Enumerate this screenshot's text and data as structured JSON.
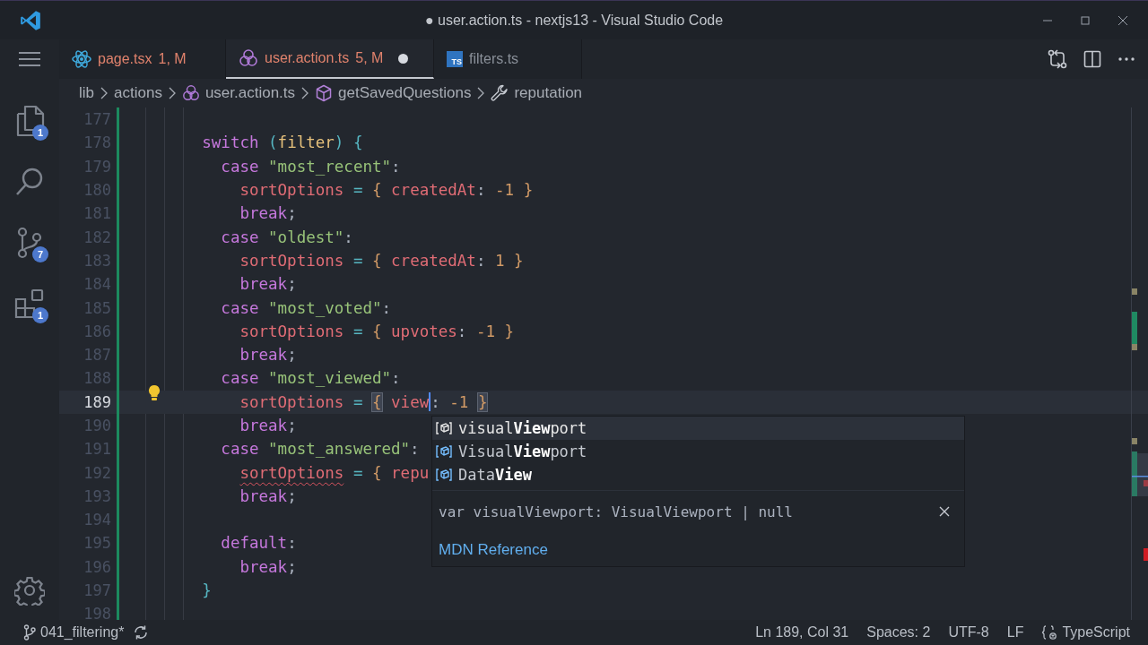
{
  "window": {
    "title": "● user.action.ts - nextjs13 - Visual Studio Code"
  },
  "activity_bar": {
    "items": [
      {
        "kind": "explorer",
        "badge": "1"
      },
      {
        "kind": "search"
      },
      {
        "kind": "source-control",
        "badge": "7"
      },
      {
        "kind": "extensions",
        "badge": "1"
      }
    ]
  },
  "tabs": [
    {
      "label": "page.tsx",
      "status": "1, M",
      "kind": "react",
      "has_errors": true,
      "dirty": false,
      "selected": false
    },
    {
      "label": "user.action.ts",
      "status": "5, M",
      "kind": "module",
      "has_errors": true,
      "dirty": true,
      "selected": true
    },
    {
      "label": "filters.ts",
      "kind": "ts",
      "icon_text": "TS",
      "has_errors": false,
      "dirty": false,
      "selected": false
    }
  ],
  "breadcrumbs": [
    {
      "label": "lib",
      "kind": "folder"
    },
    {
      "label": "actions",
      "kind": "folder"
    },
    {
      "label": "user.action.ts",
      "kind": "module"
    },
    {
      "label": "getSavedQuestions",
      "kind": "method"
    },
    {
      "label": "reputation",
      "kind": "property"
    }
  ],
  "editor": {
    "lines": [
      {
        "number": "177",
        "current": false
      },
      {
        "number": "178",
        "current": false,
        "tokens": [
          {
            "text": "        switch",
            "kind": "kw"
          },
          {
            "text": " (",
            "kind": "op"
          },
          {
            "text": "filter",
            "kind": "param"
          },
          {
            "text": ")",
            "kind": "op"
          },
          {
            "text": " {",
            "kind": "op"
          }
        ]
      },
      {
        "number": "179",
        "current": false,
        "tokens": [
          {
            "text": "          case",
            "kind": "kw"
          },
          {
            "text": " \"most_recent\"",
            "kind": "str"
          },
          {
            "text": ":",
            "kind": "plain"
          }
        ]
      },
      {
        "number": "180",
        "current": false,
        "tokens": [
          {
            "text": "            sortOptions",
            "kind": "var"
          },
          {
            "text": " =",
            "kind": "op"
          },
          {
            "text": " {",
            "kind": "brace"
          },
          {
            "text": " createdAt",
            "kind": "var"
          },
          {
            "text": ":",
            "kind": "plain"
          },
          {
            "text": " -1",
            "kind": "num"
          },
          {
            "text": " }",
            "kind": "brace"
          }
        ]
      },
      {
        "number": "181",
        "current": false,
        "tokens": [
          {
            "text": "            break",
            "kind": "kw"
          },
          {
            "text": ";",
            "kind": "plain"
          }
        ]
      },
      {
        "number": "182",
        "current": false,
        "tokens": [
          {
            "text": "          case",
            "kind": "kw"
          },
          {
            "text": " \"oldest\"",
            "kind": "str"
          },
          {
            "text": ":",
            "kind": "plain"
          }
        ]
      },
      {
        "number": "183",
        "current": false,
        "tokens": [
          {
            "text": "            sortOptions",
            "kind": "var"
          },
          {
            "text": " =",
            "kind": "op"
          },
          {
            "text": " {",
            "kind": "brace"
          },
          {
            "text": " createdAt",
            "kind": "var"
          },
          {
            "text": ":",
            "kind": "plain"
          },
          {
            "text": " 1",
            "kind": "num"
          },
          {
            "text": " }",
            "kind": "brace"
          }
        ]
      },
      {
        "number": "184",
        "current": false,
        "tokens": [
          {
            "text": "            break",
            "kind": "kw"
          },
          {
            "text": ";",
            "kind": "plain"
          }
        ]
      },
      {
        "number": "185",
        "current": false,
        "tokens": [
          {
            "text": "          case",
            "kind": "kw"
          },
          {
            "text": " \"most_voted\"",
            "kind": "str"
          },
          {
            "text": ":",
            "kind": "plain"
          }
        ]
      },
      {
        "number": "186",
        "current": false,
        "tokens": [
          {
            "text": "            sortOptions",
            "kind": "var"
          },
          {
            "text": " =",
            "kind": "op"
          },
          {
            "text": " {",
            "kind": "brace"
          },
          {
            "text": " upvotes",
            "kind": "var"
          },
          {
            "text": ":",
            "kind": "plain"
          },
          {
            "text": " -1",
            "kind": "num"
          },
          {
            "text": " }",
            "kind": "brace"
          }
        ]
      },
      {
        "number": "187",
        "current": false,
        "tokens": [
          {
            "text": "            break",
            "kind": "kw"
          },
          {
            "text": ";",
            "kind": "plain"
          }
        ]
      },
      {
        "number": "188",
        "current": false,
        "tokens": [
          {
            "text": "          case",
            "kind": "kw"
          },
          {
            "text": " \"most_viewed\"",
            "kind": "str"
          },
          {
            "text": ":",
            "kind": "plain"
          }
        ]
      },
      {
        "number": "189",
        "current": true,
        "lightbulb": true,
        "tokens": [
          {
            "text": "            sortOptions",
            "kind": "var"
          },
          {
            "text": " = ",
            "kind": "op"
          },
          {
            "text": "{",
            "kind": "brace",
            "matched": true
          },
          {
            "text": " view",
            "kind": "var",
            "cursor": true
          },
          {
            "text": ":",
            "kind": "plain"
          },
          {
            "text": " -1 ",
            "kind": "num"
          },
          {
            "text": "}",
            "kind": "brace",
            "matched": true
          }
        ]
      },
      {
        "number": "190",
        "current": false,
        "tokens": [
          {
            "text": "            break",
            "kind": "kw"
          },
          {
            "text": ";",
            "kind": "plain"
          }
        ]
      },
      {
        "number": "191",
        "current": false,
        "tokens": [
          {
            "text": "          case",
            "kind": "kw"
          },
          {
            "text": " \"most_answered\"",
            "kind": "str"
          },
          {
            "text": ":",
            "kind": "plain"
          }
        ]
      },
      {
        "number": "192",
        "current": false,
        "tokens": [
          {
            "text": "            sortOptions",
            "kind": "var",
            "error": true
          },
          {
            "text": " =",
            "kind": "op"
          },
          {
            "text": " {",
            "kind": "brace"
          },
          {
            "text": " repu",
            "kind": "var"
          }
        ]
      },
      {
        "number": "193",
        "current": false,
        "tokens": [
          {
            "text": "            break",
            "kind": "kw"
          },
          {
            "text": ";",
            "kind": "plain"
          }
        ]
      },
      {
        "number": "194",
        "current": false
      },
      {
        "number": "195",
        "current": false,
        "tokens": [
          {
            "text": "          default",
            "kind": "kw"
          },
          {
            "text": ":",
            "kind": "plain"
          }
        ]
      },
      {
        "number": "196",
        "current": false,
        "tokens": [
          {
            "text": "            break",
            "kind": "kw"
          },
          {
            "text": ";",
            "kind": "plain"
          }
        ]
      },
      {
        "number": "197",
        "current": false,
        "tokens": [
          {
            "text": "        }",
            "kind": "op"
          }
        ]
      },
      {
        "number": "198",
        "current": false
      }
    ]
  },
  "suggestions": {
    "items": [
      {
        "label": "visual**View**port",
        "selected": true
      },
      {
        "label": "Visual**View**port",
        "selected": false
      },
      {
        "label": "Data**View**",
        "selected": false
      }
    ],
    "detail": "var visualViewport: VisualViewport | null",
    "link": "MDN Reference"
  },
  "status_bar": {
    "branch": "041_filtering*",
    "position": "Ln 189, Col 31",
    "indentation": "Spaces: 2",
    "encoding": "UTF-8",
    "line_ending": "LF",
    "language": "TypeScript"
  }
}
